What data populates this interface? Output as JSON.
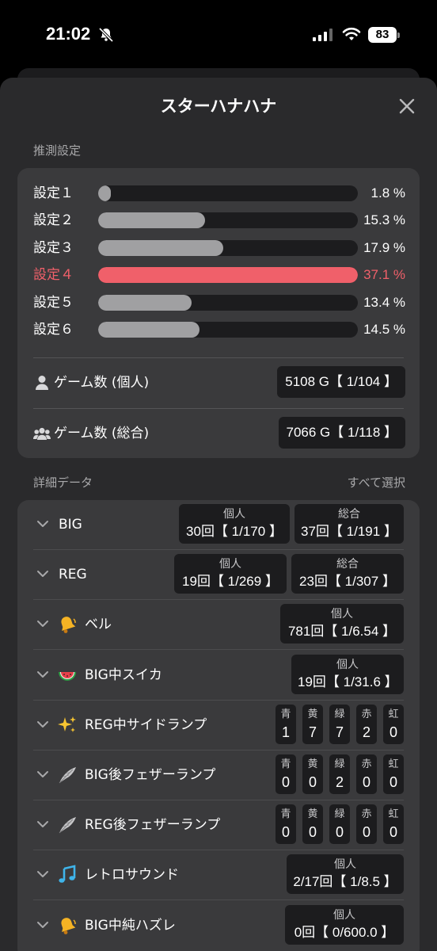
{
  "status_bar": {
    "time": "21:02",
    "battery": "83"
  },
  "title": "スターハナハナ",
  "estimate": {
    "section_label": "推測設定",
    "settings": [
      {
        "label": "設定１",
        "pct_text": "1.8 %",
        "fraction": 0.018,
        "active": false
      },
      {
        "label": "設定２",
        "pct_text": "15.3 %",
        "fraction": 0.153,
        "active": false
      },
      {
        "label": "設定３",
        "pct_text": "17.9 %",
        "fraction": 0.179,
        "active": false
      },
      {
        "label": "設定４",
        "pct_text": "37.1 %",
        "fraction": 0.371,
        "active": true
      },
      {
        "label": "設定５",
        "pct_text": "13.4 %",
        "fraction": 0.134,
        "active": false
      },
      {
        "label": "設定６",
        "pct_text": "14.5 %",
        "fraction": 0.145,
        "active": false
      }
    ],
    "games_personal": {
      "label": "ゲーム数 (個人)",
      "value": "5108 G【 1/104 】",
      "icon": "person-icon"
    },
    "games_total": {
      "label": "ゲーム数 (総合)",
      "value": "7066 G【 1/118 】",
      "icon": "group-icon"
    }
  },
  "details": {
    "section_label": "詳細データ",
    "select_all": "すべて選択",
    "colors": {
      "active": "#f0606a",
      "bar": "#a0a0a2"
    },
    "rows": [
      {
        "name": "big",
        "label": "BIG",
        "icon": "",
        "personal": {
          "head": "個人",
          "value": "30回【 1/170 】"
        },
        "total": {
          "head": "総合",
          "value": "37回【 1/191 】"
        }
      },
      {
        "name": "reg",
        "label": "REG",
        "icon": "",
        "personal": {
          "head": "個人",
          "value": "19回【 1/269 】"
        },
        "total": {
          "head": "総合",
          "value": "23回【 1/307 】"
        }
      },
      {
        "name": "bell",
        "label": "ベル",
        "icon": "bell-icon",
        "personal": {
          "head": "個人",
          "value": "781回【 1/6.54 】"
        }
      },
      {
        "name": "big-suika",
        "label": "BIG中スイカ",
        "icon": "watermelon-icon",
        "personal": {
          "head": "個人",
          "value": "19回【 1/31.6 】"
        }
      },
      {
        "name": "reg-side-lamp",
        "label": "REG中サイドランプ",
        "icon": "sparkles-icon",
        "colors": [
          {
            "head": "青",
            "value": "1"
          },
          {
            "head": "黄",
            "value": "7"
          },
          {
            "head": "緑",
            "value": "7"
          },
          {
            "head": "赤",
            "value": "2"
          },
          {
            "head": "虹",
            "value": "0"
          }
        ]
      },
      {
        "name": "big-feather-lamp",
        "label": "BIG後フェザーランプ",
        "icon": "feather-icon",
        "colors": [
          {
            "head": "青",
            "value": "0"
          },
          {
            "head": "黄",
            "value": "0"
          },
          {
            "head": "緑",
            "value": "2"
          },
          {
            "head": "赤",
            "value": "0"
          },
          {
            "head": "虹",
            "value": "0"
          }
        ]
      },
      {
        "name": "reg-feather-lamp",
        "label": "REG後フェザーランプ",
        "icon": "feather-icon",
        "colors": [
          {
            "head": "青",
            "value": "0"
          },
          {
            "head": "黄",
            "value": "0"
          },
          {
            "head": "緑",
            "value": "0"
          },
          {
            "head": "赤",
            "value": "0"
          },
          {
            "head": "虹",
            "value": "0"
          }
        ]
      },
      {
        "name": "retro-sound",
        "label": "レトロサウンド",
        "icon": "music-note-icon",
        "personal": {
          "head": "個人",
          "value": "2/17回【 1/8.5 】"
        }
      },
      {
        "name": "big-hazure",
        "label": "BIG中純ハズレ",
        "icon": "bell-icon",
        "personal": {
          "head": "個人",
          "value": "0回【 0/600.0 】"
        }
      }
    ]
  }
}
